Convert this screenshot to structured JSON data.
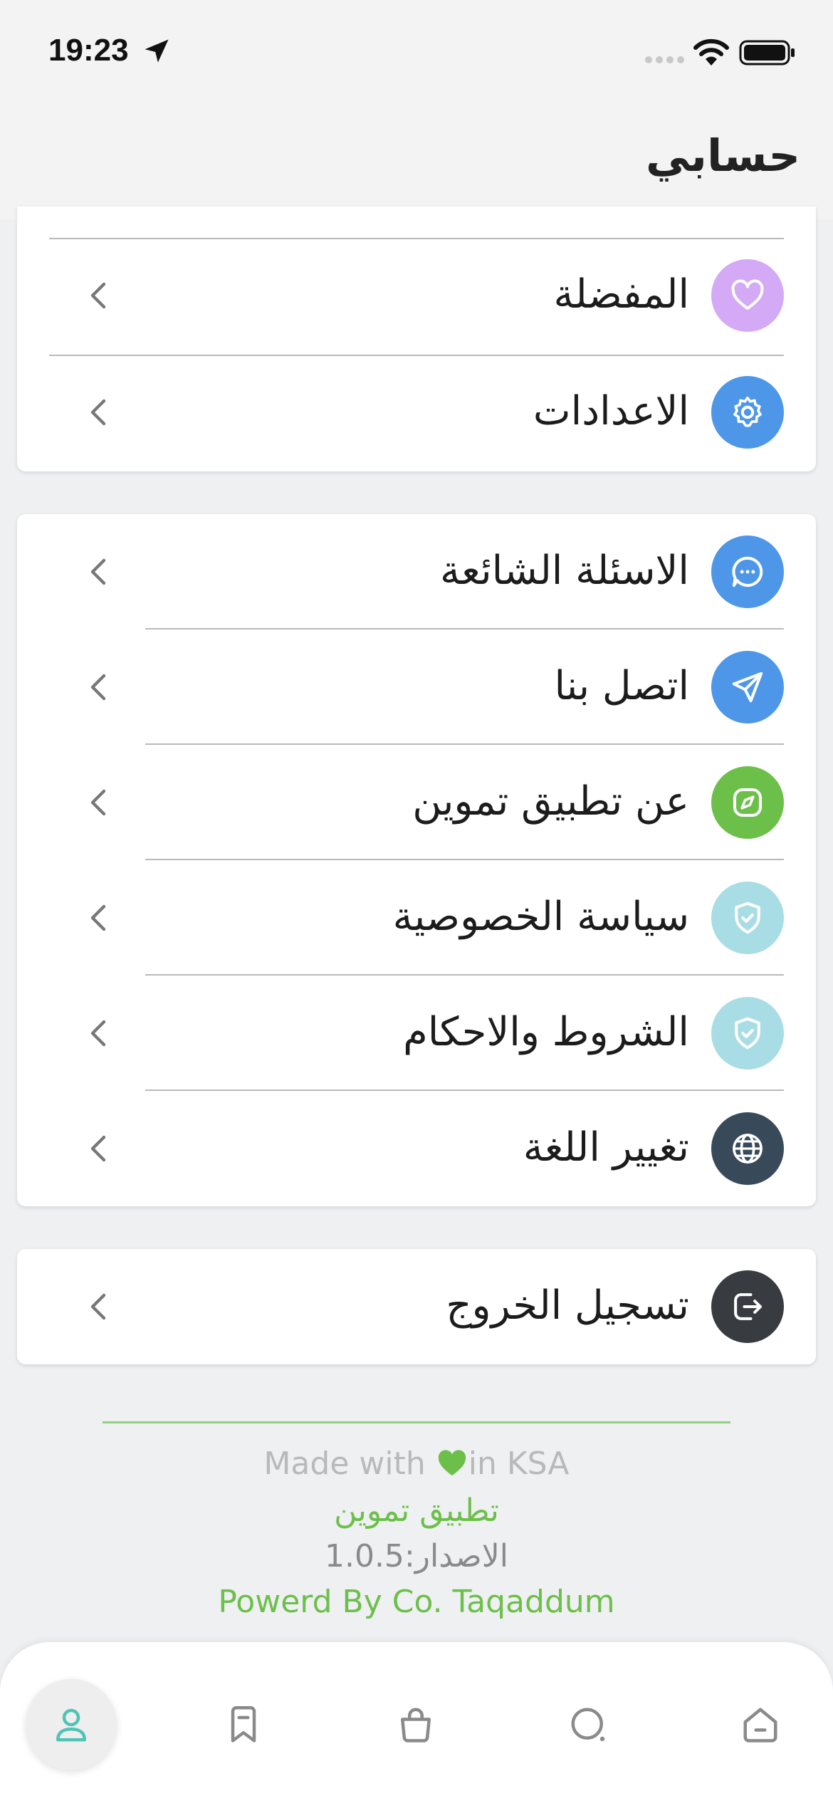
{
  "status_bar": {
    "time": "19:23"
  },
  "header": {
    "title": "حسابي"
  },
  "account_section": {
    "items": [
      {
        "label": "المفضلة",
        "icon": "heart-icon",
        "icon_bg": "#d4a9f5"
      },
      {
        "label": "الاعدادات",
        "icon": "gear-icon",
        "icon_bg": "#4e97e8"
      }
    ]
  },
  "info_section": {
    "items": [
      {
        "label": "الاسئلة الشائعة",
        "icon": "chat-bubble-icon",
        "icon_bg": "#4e97e8"
      },
      {
        "label": "اتصل بنا",
        "icon": "send-icon",
        "icon_bg": "#4e97e8"
      },
      {
        "label": "عن تطبيق تموين",
        "icon": "compass-icon",
        "icon_bg": "#6cc04a"
      },
      {
        "label": "سياسة الخصوصية",
        "icon": "shield-check-icon",
        "icon_bg": "#a9dde5"
      },
      {
        "label": "الشروط والاحكام",
        "icon": "shield-check-icon",
        "icon_bg": "#a9dde5"
      },
      {
        "label": "تغيير اللغة",
        "icon": "globe-icon",
        "icon_bg": "#384a5a"
      }
    ]
  },
  "logout_section": {
    "label": "تسجيل الخروج",
    "icon": "logout-icon",
    "icon_bg": "#383b40"
  },
  "footer": {
    "made_with_prefix": "Made with",
    "made_with_suffix": "in KSA",
    "app_name": "تطبيق تموين",
    "version": "الاصدار:1.0.5",
    "powered_by": "Powerd By Co. Taqaddum"
  },
  "tab_bar": {
    "tabs": [
      {
        "icon": "profile-icon",
        "active": true
      },
      {
        "icon": "bookmark-icon",
        "active": false
      },
      {
        "icon": "shopping-bag-icon",
        "active": false
      },
      {
        "icon": "search-icon",
        "active": false
      },
      {
        "icon": "home-icon",
        "active": false
      }
    ]
  },
  "colors": {
    "accent_green": "#6cc04a",
    "active_tab": "#4fc4b6",
    "divider": "#b9b9b9"
  }
}
